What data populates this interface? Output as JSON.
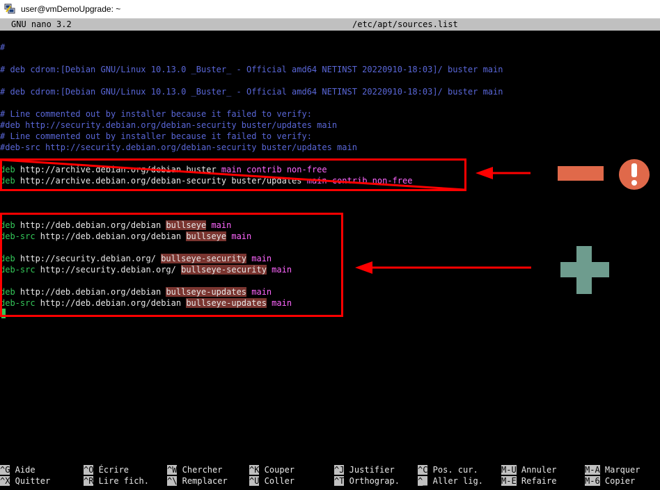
{
  "window": {
    "title": "user@vmDemoUpgrade: ~"
  },
  "nano": {
    "version": "GNU nano 3.2",
    "filename": "/etc/apt/sources.list"
  },
  "lines": {
    "l1": "#",
    "l2": "# deb cdrom:[Debian GNU/Linux 10.13.0 _Buster_ - Official amd64 NETINST 20220910-18:03]/ buster main",
    "l3": "# deb cdrom:[Debian GNU/Linux 10.13.0 _Buster_ - Official amd64 NETINST 20220910-18:03]/ buster main",
    "l4": "# Line commented out by installer because it failed to verify:",
    "l5": "#deb http://security.debian.org/debian-security buster/updates main",
    "l6": "# Line commented out by installer because it failed to verify:",
    "l7": "#deb-src http://security.debian.org/debian-security buster/updates main",
    "l8": {
      "kw": "deb",
      "url": " http://archive.debian.org/debian",
      "suite": " buster",
      "components": " main contrib non-free"
    },
    "l9": {
      "kw": "deb",
      "url": " http://archive.debian.org/debian-security",
      "suite": " buster/updates",
      "components": " main contrib non-free"
    },
    "l10": {
      "kw": "deb",
      "url": " http://deb.debian.org/debian ",
      "suite": "bullseye",
      "components": " main"
    },
    "l11": {
      "kw": "deb-src",
      "url": " http://deb.debian.org/debian ",
      "suite": "bullseye",
      "components": " main"
    },
    "l12": {
      "kw": "deb",
      "url": " http://security.debian.org/ ",
      "suite": "bullseye-security",
      "components": " main"
    },
    "l13": {
      "kw": "deb-src",
      "url": " http://security.debian.org/ ",
      "suite": "bullseye-security",
      "components": " main"
    },
    "l14": {
      "kw": "deb",
      "url": " http://deb.debian.org/debian ",
      "suite": "bullseye-updates",
      "components": " main"
    },
    "l15": {
      "kw": "deb-src",
      "url": " http://deb.debian.org/debian ",
      "suite": "bullseye-updates",
      "components": " main"
    }
  },
  "shortcuts": [
    {
      "key": "^G",
      "label": " Aide"
    },
    {
      "key": "^O",
      "label": " Écrire"
    },
    {
      "key": "^W",
      "label": " Chercher"
    },
    {
      "key": "^K",
      "label": " Couper"
    },
    {
      "key": "^J",
      "label": " Justifier"
    },
    {
      "key": "^C",
      "label": " Pos. cur."
    },
    {
      "key": "M-U",
      "label": " Annuler"
    },
    {
      "key": "M-A",
      "label": " Marquer"
    },
    {
      "key": "^X",
      "label": " Quitter"
    },
    {
      "key": "^R",
      "label": " Lire fich."
    },
    {
      "key": "^\\",
      "label": " Remplacer"
    },
    {
      "key": "^U",
      "label": " Coller"
    },
    {
      "key": "^T",
      "label": " Orthograp."
    },
    {
      "key": "^_",
      "label": " Aller lig."
    },
    {
      "key": "M-E",
      "label": " Refaire"
    },
    {
      "key": "M-6",
      "label": " Copier"
    }
  ],
  "annotations": {
    "remove_color": "#e0694a",
    "warning_color": "#e0694a",
    "warning_icon": "exclamation-icon",
    "add_color": "#6e9c8e",
    "box_color": "#ff0000"
  }
}
